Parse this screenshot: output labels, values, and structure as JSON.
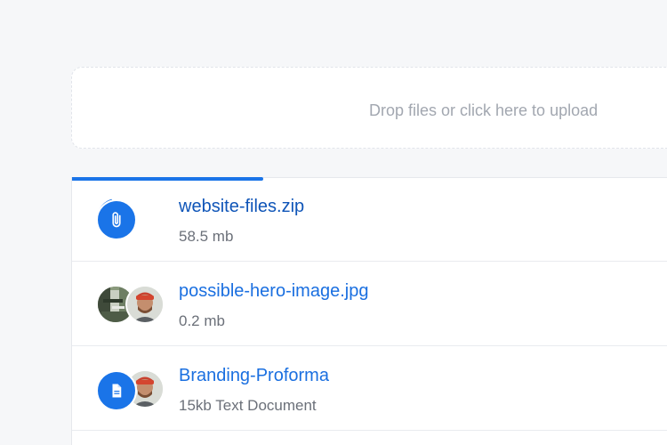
{
  "dropzone": {
    "label": "Drop files or click here to upload"
  },
  "upload_progress": 0.5,
  "files": [
    {
      "name": "website-files.zip",
      "meta": "58.5 mb",
      "icon": "paperclip-icon",
      "status": "uploading"
    },
    {
      "name": "possible-hero-image.jpg",
      "meta": "0.2 mb",
      "icon": "image-thumbnail",
      "owner": "user-avatar"
    },
    {
      "name": "Branding-Proforma",
      "meta": "15kb Text Document",
      "icon": "document-icon",
      "owner": "user-avatar"
    }
  ],
  "colors": {
    "accent": "#1a74e8",
    "link": "#1a6fe0",
    "muted_text": "#6b7079",
    "placeholder_text": "#a2a7b0",
    "background": "#f6f7f9"
  }
}
